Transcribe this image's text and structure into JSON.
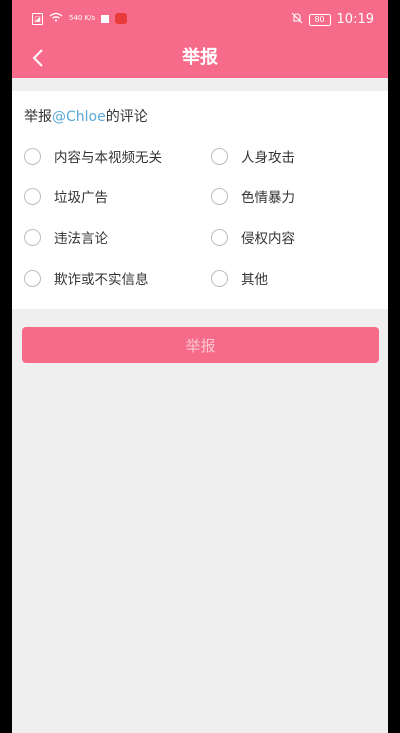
{
  "status_bar": {
    "speed": "540 K/s",
    "battery": "80",
    "time": "10:19"
  },
  "header": {
    "title": "举报"
  },
  "report": {
    "prefix": "举报",
    "mention": "@Chloe",
    "suffix": "的评论"
  },
  "options": [
    {
      "label": "内容与本视频无关",
      "checked": false
    },
    {
      "label": "人身攻击",
      "checked": false
    },
    {
      "label": "垃圾广告",
      "checked": false
    },
    {
      "label": "色情暴力",
      "checked": false
    },
    {
      "label": "违法言论",
      "checked": false
    },
    {
      "label": "侵权内容",
      "checked": false
    },
    {
      "label": "欺诈或不实信息",
      "checked": false
    },
    {
      "label": "其他",
      "checked": false
    }
  ],
  "submit": {
    "label": "举报"
  },
  "colors": {
    "brand": "#f76b8a",
    "mention": "#5aa7d8",
    "background": "#efefef"
  }
}
